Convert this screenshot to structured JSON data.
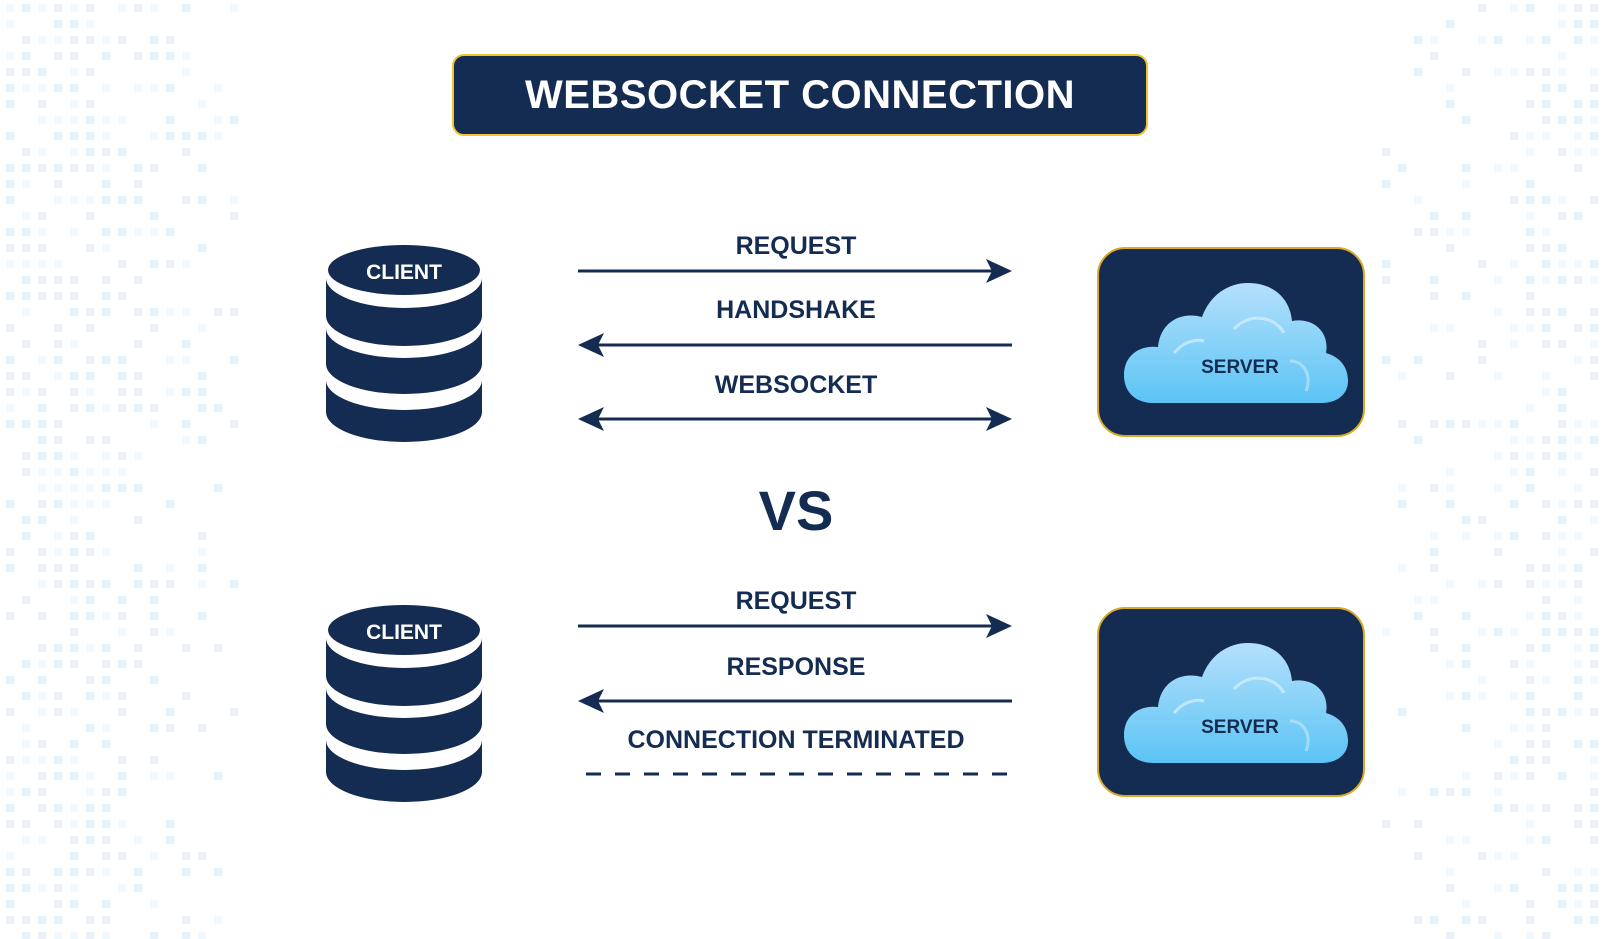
{
  "title": "WEBSOCKET CONNECTION",
  "colors": {
    "navy": "#152c52",
    "gold_border": "#f2c230",
    "cloud_top": "#b4e0fb",
    "cloud_bottom": "#5cc4f5",
    "background": "#ffffff",
    "pattern": "#d6ebf8"
  },
  "divider_label": "VS",
  "sections": [
    {
      "name": "websocket",
      "client_label": "CLIENT",
      "server_label": "SERVER",
      "messages": [
        {
          "label": "REQUEST",
          "direction": "right",
          "style": "solid"
        },
        {
          "label": "HANDSHAKE",
          "direction": "left",
          "style": "solid"
        },
        {
          "label": "WEBSOCKET",
          "direction": "both",
          "style": "solid"
        }
      ]
    },
    {
      "name": "http",
      "client_label": "CLIENT",
      "server_label": "SERVER",
      "messages": [
        {
          "label": "REQUEST",
          "direction": "right",
          "style": "solid"
        },
        {
          "label": "RESPONSE",
          "direction": "left",
          "style": "solid"
        },
        {
          "label": "CONNECTION TERMINATED",
          "direction": "none",
          "style": "dashed"
        }
      ]
    }
  ],
  "icons": {
    "client": "database-icon",
    "server": "cloud-icon"
  }
}
